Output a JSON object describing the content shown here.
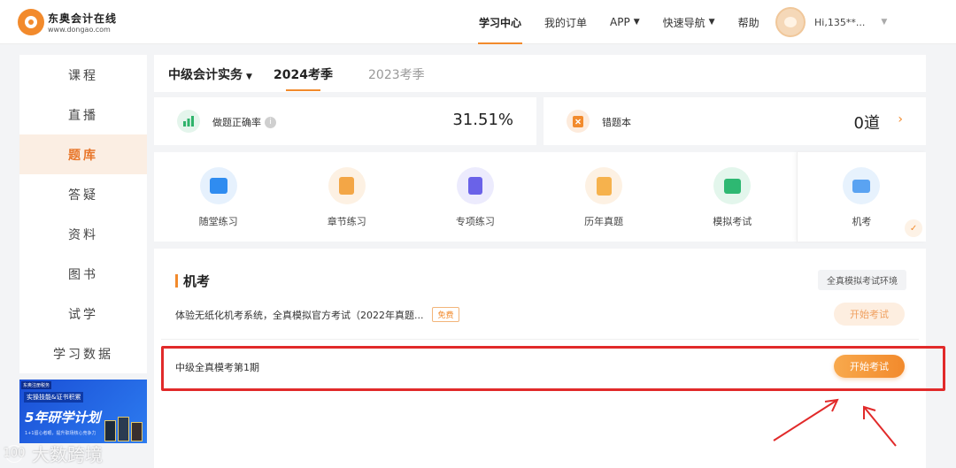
{
  "header": {
    "logo_name": "东奥会计在线",
    "logo_url": "www.dongao.com",
    "nav": [
      {
        "label": "学习中心",
        "active": true
      },
      {
        "label": "我的订单"
      },
      {
        "label": "APP",
        "caret": "▼"
      },
      {
        "label": "快速导航",
        "caret": "▼"
      },
      {
        "label": "帮助"
      }
    ],
    "user_name": "Hi,135**...",
    "user_caret": "▼"
  },
  "sidebar": {
    "items": [
      "课程",
      "直播",
      "题库",
      "答疑",
      "资料",
      "图书",
      "试学",
      "学习数据"
    ],
    "active_index": 2
  },
  "banner": {
    "tag": "东奥注册税务",
    "subtitle": "实操技能&证书积累",
    "main": "5年研学计划",
    "note": "1+1留心者眼，提升职场核心竞争力"
  },
  "topbar": {
    "subject": "中级会计实务",
    "subject_caret": "▼",
    "seasons": [
      {
        "label": "2024考季",
        "active": true
      },
      {
        "label": "2023考季"
      }
    ]
  },
  "stats": [
    {
      "label": "做题正确率",
      "info": "i",
      "value": "31.51%"
    },
    {
      "label": "错题本",
      "value": "0道",
      "chevron": "›"
    }
  ],
  "practice": [
    {
      "label": "随堂练习",
      "icon": "practice-card-icon"
    },
    {
      "label": "章节练习",
      "icon": "chapter-book-icon"
    },
    {
      "label": "专项练习",
      "icon": "special-doc-icon"
    },
    {
      "label": "历年真题",
      "icon": "past-paper-icon"
    },
    {
      "label": "模拟考试",
      "icon": "mock-exam-icon"
    },
    {
      "label": "机考",
      "icon": "computer-exam-icon",
      "selected": true,
      "check": "✓"
    }
  ],
  "exam": {
    "title": "机考",
    "env_tag": "全真模拟考试环境",
    "desc": "体验无纸化机考系统，全真模拟官方考试（2022年真题...",
    "free_tag": "免费",
    "start_label_1": "开始考试",
    "row_label": "中级全真模考第1期",
    "start_label_2": "开始考试"
  },
  "watermark": {
    "badge": "100",
    "text": "大数跨境"
  },
  "colors": {
    "accent": "#f28a2c",
    "annotation": "#e12a2a"
  }
}
